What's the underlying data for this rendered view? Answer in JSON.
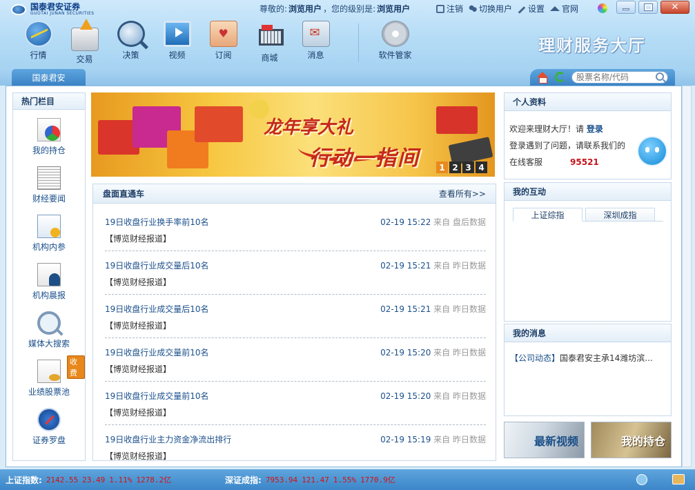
{
  "window": {
    "logo_cn": "国泰君安证券",
    "logo_en": "GUOTAI JUNAN SECURITIES",
    "greeting_prefix": "尊敬的:",
    "greeting_user": "浏览用户",
    "greeting_level_prefix": "，您的级别是:",
    "greeting_level": "浏览用户",
    "links": {
      "logout": "注销",
      "switch_user": "切换用户",
      "settings": "设置",
      "website": "官网"
    },
    "close_symbol": "✕"
  },
  "toolbar": {
    "items": [
      {
        "label": "行情",
        "icon": "market-chart-icon"
      },
      {
        "label": "交易",
        "icon": "trade-icon"
      },
      {
        "label": "决策",
        "icon": "decision-magnifier-icon"
      },
      {
        "label": "视频",
        "icon": "video-icon"
      },
      {
        "label": "订阅",
        "icon": "subscribe-icon"
      },
      {
        "label": "商城",
        "icon": "shopping-cart-icon"
      },
      {
        "label": "消息",
        "icon": "message-icon"
      }
    ],
    "software_manager": "软件管家",
    "hall_title": "理财服务大厅"
  },
  "tabs": {
    "main": "国泰君安",
    "search_placeholder": "股票名称/代码"
  },
  "leftnav": {
    "title": "热门栏目",
    "items": [
      {
        "label": "我的持仓",
        "icon": "holdings-pie-icon"
      },
      {
        "label": "财经要闻",
        "icon": "newspaper-icon"
      },
      {
        "label": "机构内参",
        "icon": "report-icon"
      },
      {
        "label": "机构晨报",
        "icon": "morning-report-icon"
      },
      {
        "label": "媒体大搜索",
        "icon": "media-search-icon"
      },
      {
        "label": "业绩股票池",
        "icon": "stock-pool-icon",
        "badge": "收费"
      },
      {
        "label": "证券罗盘",
        "icon": "compass-icon"
      }
    ]
  },
  "banner": {
    "line1": "龙年享大礼",
    "line2": "行动一指间",
    "pages": [
      "1",
      "2",
      "3",
      "4"
    ],
    "active_page": "1"
  },
  "news": {
    "title": "盘面直通车",
    "more": "查看所有>>",
    "rows": [
      {
        "title": "19日收盘行业换手率前10名",
        "time": "02-19 15:22",
        "from": "来自 盘后数据",
        "source": "【博览财经报道】"
      },
      {
        "title": "19日收盘行业成交量后10名",
        "time": "02-19 15:21",
        "from": "来自 昨日数据",
        "source": "【博览财经报道】"
      },
      {
        "title": "19日收盘行业成交量后10名",
        "time": "02-19 15:21",
        "from": "来自 昨日数据",
        "source": "【博览财经报道】"
      },
      {
        "title": "19日收盘行业成交量前10名",
        "time": "02-19 15:20",
        "from": "来自 昨日数据",
        "source": "【博览财经报道】"
      },
      {
        "title": "19日收盘行业成交量前10名",
        "time": "02-19 15:20",
        "from": "来自 昨日数据",
        "source": "【博览财经报道】"
      },
      {
        "title": "19日收盘行业主力资金净流出排行",
        "time": "02-19 15:19",
        "from": "来自 昨日数据",
        "source": "【博览财经报道】"
      }
    ]
  },
  "profile": {
    "title": "个人资料",
    "welcome": "欢迎来理财大厅！请",
    "login": "登录",
    "help": "登录遇到了问题，请联系我们的",
    "service": "在线客服",
    "phone": "95521"
  },
  "interaction": {
    "title": "我的互动",
    "tabs": [
      "上证综指",
      "深圳成指"
    ]
  },
  "messages": {
    "title": "我的消息",
    "tag": "【公司动态】",
    "text": "国泰君安主承14潍坊滨..."
  },
  "promos": {
    "video": "最新视频",
    "holdings": "我的持仓"
  },
  "statusbar": {
    "sh_label": "上证指数:",
    "sh_value": "2142.55",
    "sh_change": "23.49",
    "sh_pct": "1.11%",
    "sh_amount": "1278.2亿",
    "sz_label": "深证成指:",
    "sz_value": "7953.94",
    "sz_change": "121.47",
    "sz_pct": "1.55%",
    "sz_amount": "1770.9亿"
  }
}
